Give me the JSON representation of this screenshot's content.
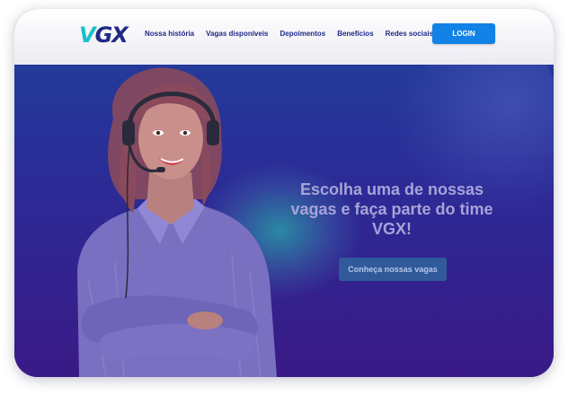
{
  "brand": {
    "logo_v": "V",
    "logo_gx": "GX",
    "accent": "#17c1cc",
    "navy": "#1f2a86"
  },
  "nav": {
    "items": [
      {
        "label": "Nossa história"
      },
      {
        "label": "Vagas disponíveis"
      },
      {
        "label": "Depoimentos"
      },
      {
        "label": "Benefícios"
      },
      {
        "label": "Redes sociais"
      }
    ],
    "login_label": "LOGIN"
  },
  "hero": {
    "headline": "Escolha uma de nossas vagas e faça parte do time VGX!",
    "cta_label": "Conheça nossas vagas",
    "image": "woman-with-headset"
  }
}
